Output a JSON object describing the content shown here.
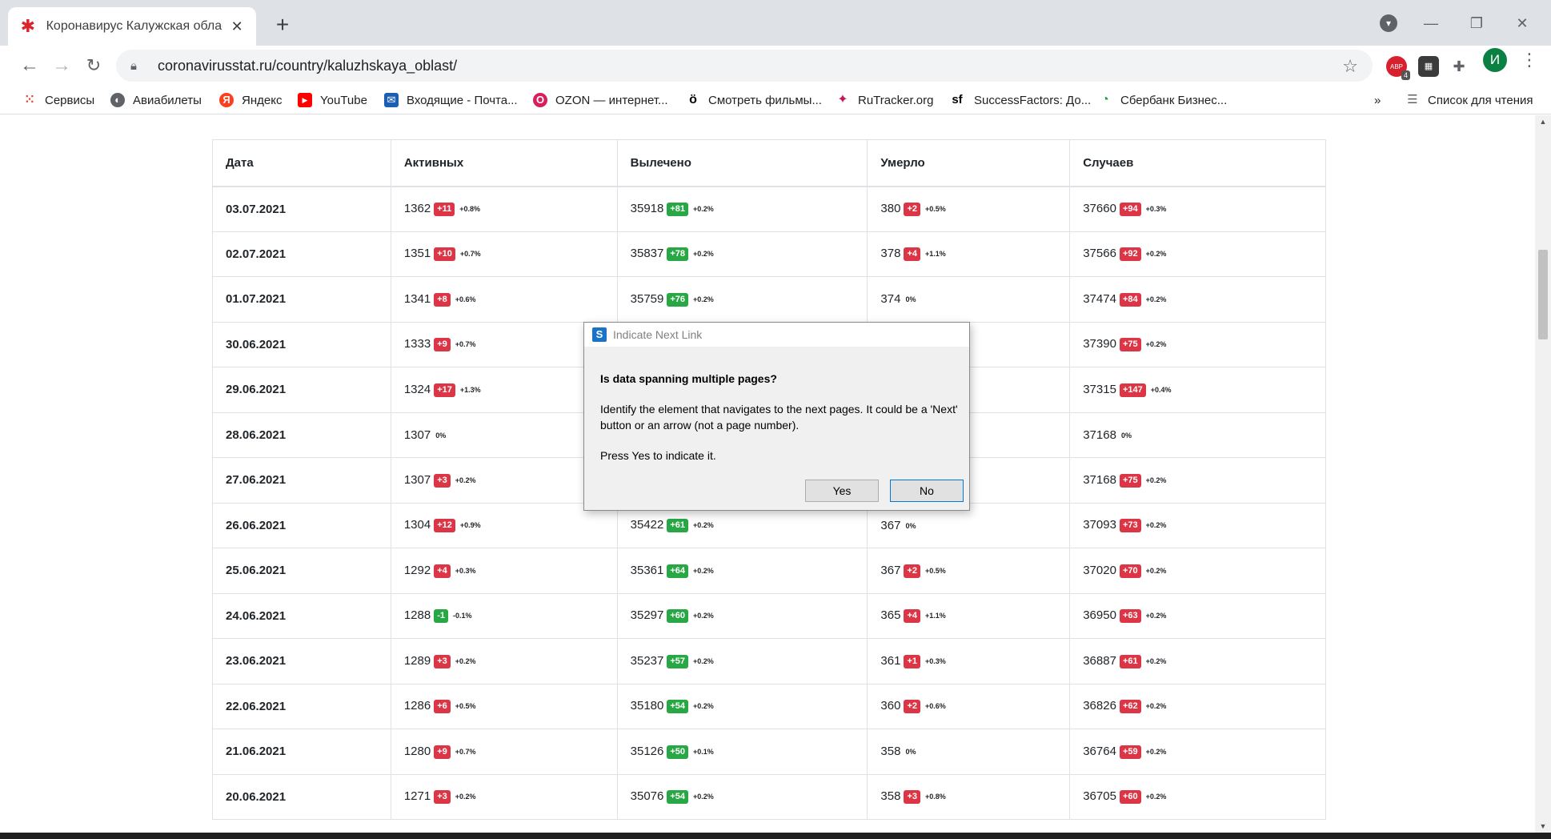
{
  "browser": {
    "tab_title": "Коронавирус Калужская облас",
    "url": "coronavirusstat.ru/country/kaluzhskaya_oblast/",
    "profile_initial": "И",
    "ext_badge": "4",
    "ext_abp_label": "ABP",
    "new_tab": "+",
    "bookmarks": [
      {
        "label": "Сервисы",
        "icon": "apps-grid-icon",
        "color": "#ea4335"
      },
      {
        "label": "Авиабилеты",
        "icon": "globe-icon",
        "color": "#5f6368"
      },
      {
        "label": "Яндекс",
        "icon": "yandex-icon",
        "color": "#fc3f1d"
      },
      {
        "label": "YouTube",
        "icon": "youtube-icon",
        "color": "#ff0000"
      },
      {
        "label": "Входящие - Почта...",
        "icon": "mail-icon",
        "color": "#1a5fb4"
      },
      {
        "label": "OZON — интернет...",
        "icon": "ozon-icon",
        "color": "#d81e5b"
      },
      {
        "label": "Смотреть фильмы...",
        "icon": "film-icon",
        "color": "#000000"
      },
      {
        "label": "RuTracker.org",
        "icon": "rutracker-icon",
        "color": "#c2185b"
      },
      {
        "label": "SuccessFactors: До...",
        "icon": "sf-icon",
        "color": "#000000"
      },
      {
        "label": "Сбербанк Бизнес...",
        "icon": "sber-icon",
        "color": "#21a038"
      }
    ],
    "reading_list": "Список для чтения",
    "more_bookmarks": "»"
  },
  "table": {
    "headers": [
      "Дата",
      "Активных",
      "Вылечено",
      "Умерло",
      "Случаев"
    ],
    "rows": [
      {
        "date": "03.07.2021",
        "active": "1362",
        "active_d": "+11",
        "active_c": "red",
        "active_p": "+0.8%",
        "rec": "35918",
        "rec_d": "+81",
        "rec_c": "green",
        "rec_p": "+0.2%",
        "dead": "380",
        "dead_d": "+2",
        "dead_c": "red",
        "dead_p": "+0.5%",
        "cases": "37660",
        "cases_d": "+94",
        "cases_c": "red",
        "cases_p": "+0.3%"
      },
      {
        "date": "02.07.2021",
        "active": "1351",
        "active_d": "+10",
        "active_c": "red",
        "active_p": "+0.7%",
        "rec": "35837",
        "rec_d": "+78",
        "rec_c": "green",
        "rec_p": "+0.2%",
        "dead": "378",
        "dead_d": "+4",
        "dead_c": "red",
        "dead_p": "+1.1%",
        "cases": "37566",
        "cases_d": "+92",
        "cases_c": "red",
        "cases_p": "+0.2%"
      },
      {
        "date": "01.07.2021",
        "active": "1341",
        "active_d": "+8",
        "active_c": "red",
        "active_p": "+0.6%",
        "rec": "35759",
        "rec_d": "+76",
        "rec_c": "green",
        "rec_p": "+0.2%",
        "dead": "374",
        "dead_d": "",
        "dead_c": "",
        "dead_p": "0%",
        "cases": "37474",
        "cases_d": "+84",
        "cases_c": "red",
        "cases_p": "+0.2%"
      },
      {
        "date": "30.06.2021",
        "active": "1333",
        "active_d": "+9",
        "active_c": "red",
        "active_p": "+0.7%",
        "rec": "",
        "rec_d": "",
        "rec_c": "",
        "rec_p": "",
        "dead": "",
        "dead_d": "",
        "dead_c": "",
        "dead_p": "",
        "cases": "37390",
        "cases_d": "+75",
        "cases_c": "red",
        "cases_p": "+0.2%"
      },
      {
        "date": "29.06.2021",
        "active": "1324",
        "active_d": "+17",
        "active_c": "red",
        "active_p": "+1.3%",
        "rec": "",
        "rec_d": "",
        "rec_c": "",
        "rec_p": "",
        "dead": "",
        "dead_d": "",
        "dead_c": "",
        "dead_p": "",
        "cases": "37315",
        "cases_d": "+147",
        "cases_c": "red",
        "cases_p": "+0.4%"
      },
      {
        "date": "28.06.2021",
        "active": "1307",
        "active_d": "",
        "active_c": "",
        "active_p": "0%",
        "rec": "",
        "rec_d": "",
        "rec_c": "",
        "rec_p": "",
        "dead": "",
        "dead_d": "",
        "dead_c": "",
        "dead_p": "",
        "cases": "37168",
        "cases_d": "",
        "cases_c": "",
        "cases_p": "0%"
      },
      {
        "date": "27.06.2021",
        "active": "1307",
        "active_d": "+3",
        "active_c": "red",
        "active_p": "+0.2%",
        "rec": "",
        "rec_d": "",
        "rec_c": "",
        "rec_p": "",
        "dead": "",
        "dead_d": "",
        "dead_c": "",
        "dead_p": "",
        "cases": "37168",
        "cases_d": "+75",
        "cases_c": "red",
        "cases_p": "+0.2%"
      },
      {
        "date": "26.06.2021",
        "active": "1304",
        "active_d": "+12",
        "active_c": "red",
        "active_p": "+0.9%",
        "rec": "35422",
        "rec_d": "+61",
        "rec_c": "green",
        "rec_p": "+0.2%",
        "dead": "367",
        "dead_d": "",
        "dead_c": "",
        "dead_p": "0%",
        "cases": "37093",
        "cases_d": "+73",
        "cases_c": "red",
        "cases_p": "+0.2%"
      },
      {
        "date": "25.06.2021",
        "active": "1292",
        "active_d": "+4",
        "active_c": "red",
        "active_p": "+0.3%",
        "rec": "35361",
        "rec_d": "+64",
        "rec_c": "green",
        "rec_p": "+0.2%",
        "dead": "367",
        "dead_d": "+2",
        "dead_c": "red",
        "dead_p": "+0.5%",
        "cases": "37020",
        "cases_d": "+70",
        "cases_c": "red",
        "cases_p": "+0.2%"
      },
      {
        "date": "24.06.2021",
        "active": "1288",
        "active_d": "-1",
        "active_c": "green",
        "active_p": "-0.1%",
        "rec": "35297",
        "rec_d": "+60",
        "rec_c": "green",
        "rec_p": "+0.2%",
        "dead": "365",
        "dead_d": "+4",
        "dead_c": "red",
        "dead_p": "+1.1%",
        "cases": "36950",
        "cases_d": "+63",
        "cases_c": "red",
        "cases_p": "+0.2%"
      },
      {
        "date": "23.06.2021",
        "active": "1289",
        "active_d": "+3",
        "active_c": "red",
        "active_p": "+0.2%",
        "rec": "35237",
        "rec_d": "+57",
        "rec_c": "green",
        "rec_p": "+0.2%",
        "dead": "361",
        "dead_d": "+1",
        "dead_c": "red",
        "dead_p": "+0.3%",
        "cases": "36887",
        "cases_d": "+61",
        "cases_c": "red",
        "cases_p": "+0.2%"
      },
      {
        "date": "22.06.2021",
        "active": "1286",
        "active_d": "+6",
        "active_c": "red",
        "active_p": "+0.5%",
        "rec": "35180",
        "rec_d": "+54",
        "rec_c": "green",
        "rec_p": "+0.2%",
        "dead": "360",
        "dead_d": "+2",
        "dead_c": "red",
        "dead_p": "+0.6%",
        "cases": "36826",
        "cases_d": "+62",
        "cases_c": "red",
        "cases_p": "+0.2%"
      },
      {
        "date": "21.06.2021",
        "active": "1280",
        "active_d": "+9",
        "active_c": "red",
        "active_p": "+0.7%",
        "rec": "35126",
        "rec_d": "+50",
        "rec_c": "green",
        "rec_p": "+0.1%",
        "dead": "358",
        "dead_d": "",
        "dead_c": "",
        "dead_p": "0%",
        "cases": "36764",
        "cases_d": "+59",
        "cases_c": "red",
        "cases_p": "+0.2%"
      },
      {
        "date": "20.06.2021",
        "active": "1271",
        "active_d": "+3",
        "active_c": "red",
        "active_p": "+0.2%",
        "rec": "35076",
        "rec_d": "+54",
        "rec_c": "green",
        "rec_p": "+0.2%",
        "dead": "358",
        "dead_d": "+3",
        "dead_c": "red",
        "dead_p": "+0.8%",
        "cases": "36705",
        "cases_d": "+60",
        "cases_c": "red",
        "cases_p": "+0.2%"
      }
    ]
  },
  "dialog": {
    "title": "Indicate Next Link",
    "heading": "Is data spanning multiple pages?",
    "body": "Identify the element that navigates to the next pages. It could be a 'Next' button or an arrow (not a page number).",
    "prompt": "Press Yes to indicate it.",
    "yes_label": "Yes",
    "no_label": "No"
  },
  "colors": {
    "badge_red": "#dc3545",
    "badge_green": "#28a745",
    "profile_green": "#0b8043"
  }
}
